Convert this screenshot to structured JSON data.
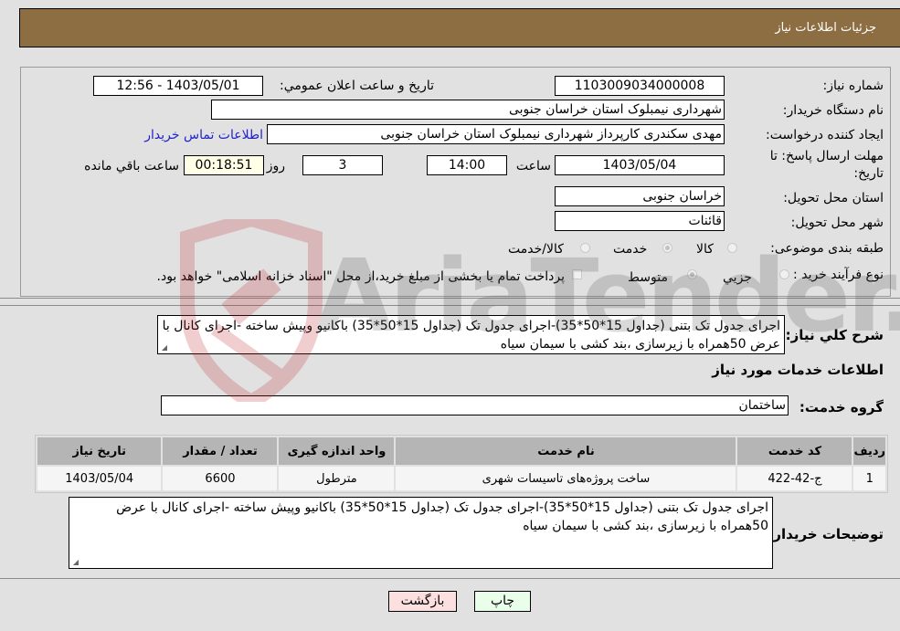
{
  "header": {
    "title": "جزئیات اطلاعات نیاز"
  },
  "fields": {
    "need_number_label": "شماره نیاز:",
    "need_number": "1103009034000008",
    "announce_label": "تاریخ و ساعت اعلان عمومي:",
    "announce_value": "1403/05/01 - 12:56",
    "buyer_org_label": "نام دستگاه خریدار:",
    "buyer_org": "شهرداری نیمبلوک استان خراسان جنوبی",
    "requester_label": "ایجاد کننده درخواست:",
    "requester": "مهدی سکندری کارپرداز شهرداری نیمبلوک استان خراسان جنوبی",
    "contact_link": "اطلاعات تماس خریدار",
    "deadline_label_line1": "مهلت ارسال پاسخ: تا",
    "deadline_label_line2": "تاریخ:",
    "deadline_date": "1403/05/04",
    "time_label": "ساعت",
    "deadline_time": "14:00",
    "days_value": "3",
    "days_label": "روز و",
    "remaining_time": "00:18:51",
    "remaining_label": "ساعت باقي مانده",
    "province_label": "استان محل تحویل:",
    "province": "خراسان جنوبی",
    "city_label": "شهر محل تحویل:",
    "city": "قائنات",
    "category_label": "طبقه بندی موضوعی:",
    "category_options": [
      {
        "label": "کالا",
        "selected": false
      },
      {
        "label": "خدمت",
        "selected": true
      },
      {
        "label": "کالا/خدمت",
        "selected": false
      }
    ],
    "process_label": "نوع فرآیند خرید :",
    "process_options": [
      {
        "label": "جزيي",
        "selected": false
      },
      {
        "label": "متوسط",
        "selected": true
      }
    ],
    "treasury_checkbox_label": "پرداخت تمام یا بخشی از مبلغ خرید،از محل \"اسناد خزانه اسلامی\" خواهد بود.",
    "treasury_checked": false
  },
  "description": {
    "label": "شرح کلي نیاز:",
    "text": "اجرای جدول تک بتنی (جداول 15*50*35)-اجرای جدول تک (جداول 15*50*35) باکانیو وپیش ساخته -اجرای کانال با عرض 50همراه با زیرسازی ،بند کشی با سیمان سیاه"
  },
  "services_section": {
    "title": "اطلاعات خدمات مورد نیاز",
    "group_label": "گروه خدمت:",
    "group_value": "ساختمان"
  },
  "table": {
    "headers": [
      "ردیف",
      "کد خدمت",
      "نام خدمت",
      "واحد اندازه گیری",
      "تعداد / مقدار",
      "تاریخ نیاز"
    ],
    "rows": [
      [
        "1",
        "ج-42-422",
        "ساخت پروژه‌های تاسیسات شهری",
        "مترطول",
        "6600",
        "1403/05/04"
      ]
    ]
  },
  "buyer_notes": {
    "label": "توضیحات خریدار:",
    "text": "اجرای جدول تک بتنی (جداول 15*50*35)-اجرای جدول تک (جداول 15*50*35) باکانیو وپیش ساخته -اجرای کانال با عرض 50همراه با زیرسازی ،بند کشی با سیمان سیاه"
  },
  "buttons": {
    "print": "چاپ",
    "back": "بازگشت"
  },
  "watermark": {
    "text": "AriaTender.neT"
  }
}
